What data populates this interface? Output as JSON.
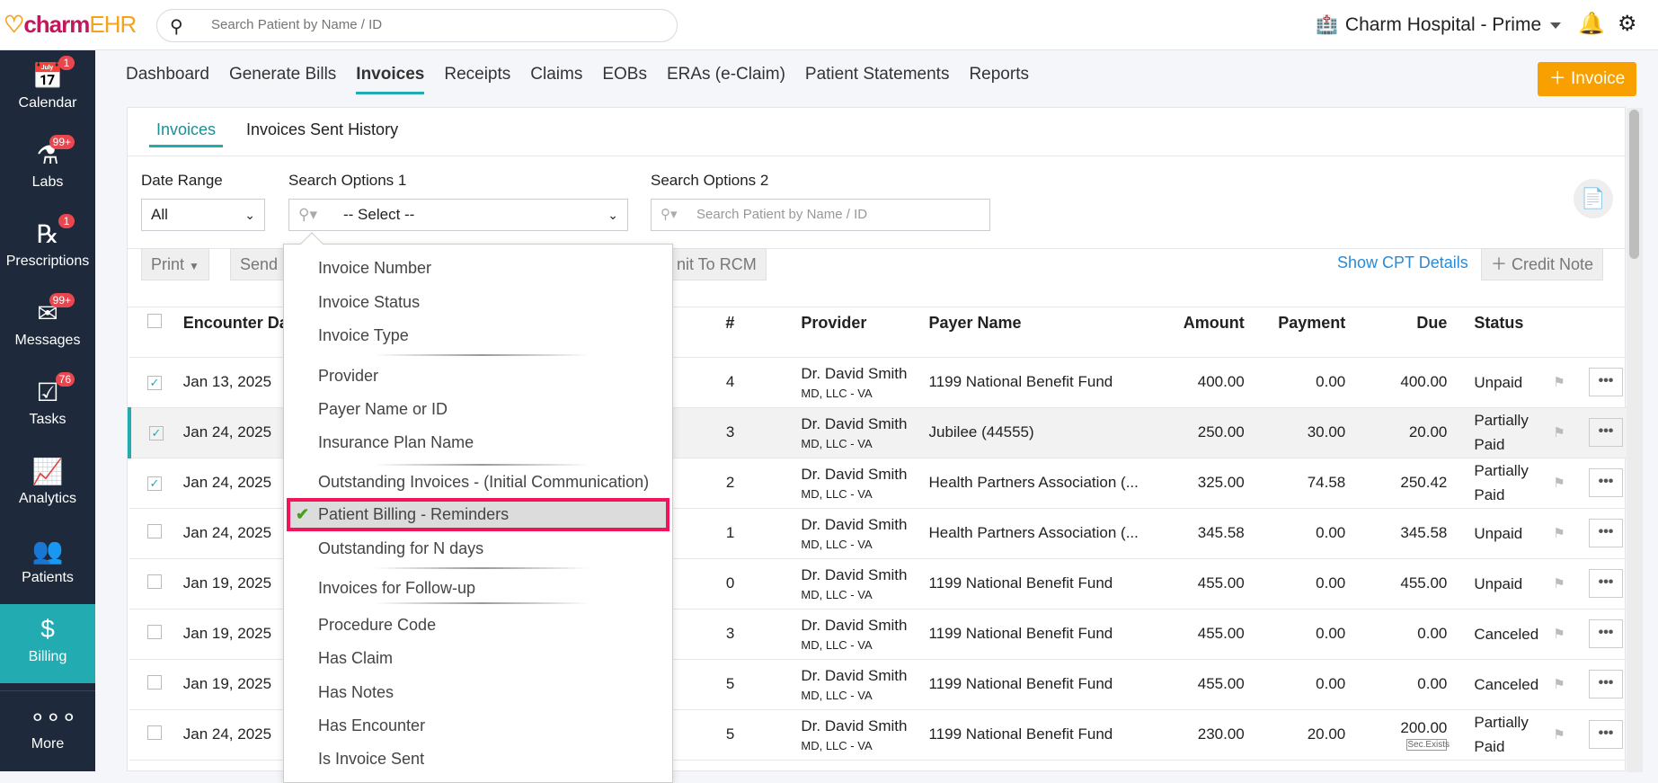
{
  "header": {
    "logo_a": "charm",
    "logo_b": "EHR",
    "search_placeholder": "Search Patient by Name / ID",
    "facility": "Charm Hospital - Prime"
  },
  "sidebar": [
    {
      "label": "Calendar",
      "badge": "1",
      "icon": "calendar-icon"
    },
    {
      "label": "Labs",
      "badge": "99+",
      "icon": "flask-icon"
    },
    {
      "label": "Prescriptions",
      "badge": "1",
      "icon": "rx-icon"
    },
    {
      "label": "Messages",
      "badge": "99+",
      "icon": "envelope-icon"
    },
    {
      "label": "Tasks",
      "badge": "76",
      "icon": "tasks-icon"
    },
    {
      "label": "Analytics",
      "badge": "",
      "icon": "chart-icon"
    },
    {
      "label": "Patients",
      "badge": "",
      "icon": "users-icon"
    },
    {
      "label": "Billing",
      "badge": "",
      "icon": "billing-icon",
      "active": true
    },
    {
      "label": "More",
      "badge": "",
      "icon": "more-icon"
    }
  ],
  "nav": [
    "Dashboard",
    "Generate Bills",
    "Invoices",
    "Receipts",
    "Claims",
    "EOBs",
    "ERAs (e-Claim)",
    "Patient Statements",
    "Reports"
  ],
  "add_invoice": "Invoice",
  "subtabs": [
    "Invoices",
    "Invoices Sent History"
  ],
  "filters": {
    "date_range_label": "Date Range",
    "date_range_value": "All",
    "opt1_label": "Search Options 1",
    "opt1_value": "-- Select --",
    "opt2_label": "Search Options 2",
    "opt2_placeholder": "Search Patient by Name / ID"
  },
  "toolbar": {
    "print": "Print",
    "send": "Send I",
    "rcm": "nit To RCM",
    "show_cpt": "Show CPT Details",
    "credit_note": "Credit Note"
  },
  "table": {
    "headers": {
      "date": "Encounter Date",
      "num": "#",
      "provider": "Provider",
      "payer": "Payer Name",
      "amount": "Amount",
      "payment": "Payment",
      "due": "Due",
      "status": "Status"
    },
    "rows": [
      {
        "checked": true,
        "date": "Jan 13, 2025",
        "num": "4",
        "prov": "Dr. David Smith",
        "prov2": "MD, LLC - VA",
        "payer": "1199 National Benefit Fund",
        "amount": "400.00",
        "payment": "0.00",
        "due": "400.00",
        "status": "Unpaid"
      },
      {
        "checked": true,
        "date": "Jan 24, 2025",
        "num": "3",
        "prov": "Dr. David Smith",
        "prov2": "MD, LLC - VA",
        "payer": "Jubilee (44555)",
        "amount": "250.00",
        "payment": "30.00",
        "due": "20.00",
        "status": "Partially Paid",
        "hl": true
      },
      {
        "checked": true,
        "date": "Jan 24, 2025",
        "num": "2",
        "prov": "Dr. David Smith",
        "prov2": "MD, LLC - VA",
        "payer": "Health Partners Association (...",
        "amount": "325.00",
        "payment": "74.58",
        "due": "250.42",
        "status": "Partially Paid"
      },
      {
        "checked": false,
        "date": "Jan 24, 2025",
        "num": "1",
        "prov": "Dr. David Smith",
        "prov2": "MD, LLC - VA",
        "payer": "Health Partners Association (...",
        "amount": "345.58",
        "payment": "0.00",
        "due": "345.58",
        "status": "Unpaid"
      },
      {
        "checked": false,
        "date": "Jan 19, 2025",
        "num": "0",
        "prov": "Dr. David Smith",
        "prov2": "MD, LLC - VA",
        "payer": "1199 National Benefit Fund",
        "amount": "455.00",
        "payment": "0.00",
        "due": "455.00",
        "status": "Unpaid"
      },
      {
        "checked": false,
        "date": "Jan 19, 2025",
        "num": "3",
        "prov": "Dr. David Smith",
        "prov2": "MD, LLC - VA",
        "payer": "1199 National Benefit Fund",
        "amount": "455.00",
        "payment": "0.00",
        "due": "0.00",
        "status": "Canceled"
      },
      {
        "checked": false,
        "date": "Jan 19, 2025",
        "num": "5",
        "prov": "Dr. David Smith",
        "prov2": "MD, LLC - VA",
        "payer": "1199 National Benefit Fund",
        "amount": "455.00",
        "payment": "0.00",
        "due": "0.00",
        "status": "Canceled"
      },
      {
        "checked": false,
        "date": "Jan 24, 2025",
        "num": "5",
        "prov": "Dr. David Smith",
        "prov2": "MD, LLC - VA",
        "payer": "1199 National Benefit Fund",
        "amount": "230.00",
        "payment": "20.00",
        "due": "200.00",
        "due_tag": "Sec.Exists",
        "status": "Partially Paid"
      }
    ]
  },
  "dropdown": {
    "options": [
      "Invoice Number",
      "Invoice Status",
      "Invoice Type",
      "Provider",
      "Payer Name or ID",
      "Insurance Plan Name",
      "Outstanding Invoices - (Initial Communication)",
      "Patient Billing - Reminders",
      "Outstanding for N days",
      "Invoices for Follow-up",
      "Procedure Code",
      "Has Claim",
      "Has Notes",
      "Has Encounter",
      "Is Invoice Sent"
    ],
    "selected": "Patient Billing - Reminders"
  },
  "colors": {
    "accent": "#22abb1",
    "brand_orange": "#f7a000",
    "sidebar": "#1e2a3b",
    "highlight_border": "#f0145a"
  }
}
